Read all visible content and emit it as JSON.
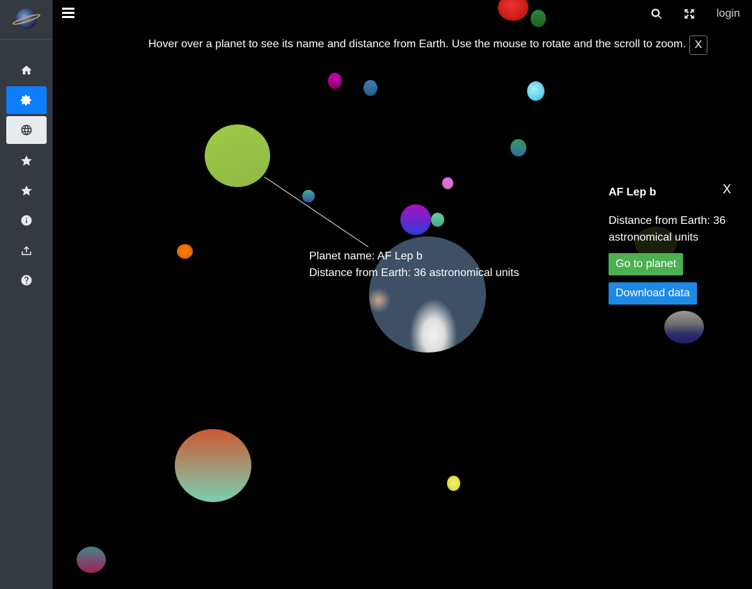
{
  "app": {
    "login_label": "login"
  },
  "sidebar": {
    "items": [
      {
        "icon": "home-icon",
        "state": "plain"
      },
      {
        "icon": "gear-icon",
        "state": "active"
      },
      {
        "icon": "globe-icon",
        "state": "selected"
      },
      {
        "icon": "star-icon",
        "state": "plain"
      },
      {
        "icon": "star-icon",
        "state": "plain"
      },
      {
        "icon": "info-icon",
        "state": "plain"
      },
      {
        "icon": "upload-icon",
        "state": "plain"
      },
      {
        "icon": "help-icon",
        "state": "plain"
      }
    ]
  },
  "hint": {
    "text": "Hover over a planet to see its name and distance from Earth. Use the mouse to rotate and the scroll to zoom.",
    "close_label": "X"
  },
  "tooltip": {
    "name_line": "Planet name: AF Lep b",
    "distance_line": "Distance from Earth: 36 astronomical units"
  },
  "panel": {
    "title": "AF Lep b",
    "distance": "Distance from Earth: 36 astronomical units",
    "close_label": "X",
    "go_button": "Go to planet",
    "download_button": "Download data"
  },
  "colors": {
    "sidebar_bg": "#343a40",
    "active_blue": "#0d7dfc",
    "go_green": "#4caf50",
    "download_blue": "#1e88e5"
  }
}
